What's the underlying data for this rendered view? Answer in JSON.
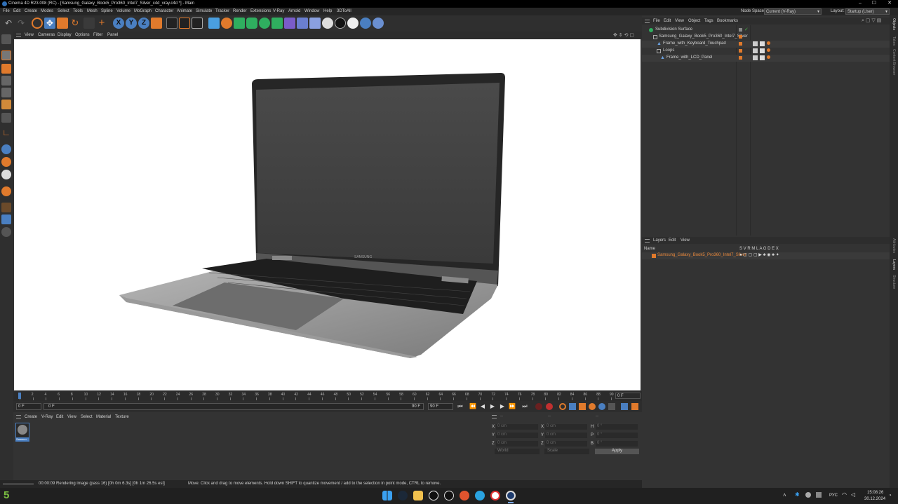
{
  "window": {
    "title": "Cinema 4D R23.008 (RC) - [Samsung_Galaxy_Book5_Pro360_Intel7_Silver_c4d_vray.c4d *] - Main",
    "controls": [
      "–",
      "☐",
      "✕"
    ]
  },
  "menubar": {
    "items": [
      "File",
      "Edit",
      "Create",
      "Modes",
      "Select",
      "Tools",
      "Mesh",
      "Spline",
      "Volume",
      "MoGraph",
      "Character",
      "Animate",
      "Simulate",
      "Tracker",
      "Render",
      "Extensions",
      "V-Ray",
      "Arnold",
      "Window",
      "Help",
      "3DToAll"
    ],
    "node_space_label": "Node Space:",
    "node_space_value": "Current (V-Ray)",
    "layout_label": "Layout:",
    "layout_value": "Startup (User)"
  },
  "toolbar": {
    "axis_x": "X",
    "axis_y": "Y",
    "axis_z": "Z",
    "icons": [
      "undo-icon",
      "redo-icon",
      "live-select-icon",
      "move-icon",
      "scale-icon",
      "rotate-icon",
      "recent-icon",
      "add-icon",
      "x-axis-icon",
      "y-axis-icon",
      "z-axis-icon",
      "coord-system-icon",
      "render-region-icon",
      "render-view-icon",
      "render-settings-icon",
      "cube-icon",
      "subdivision-icon",
      "boole-icon",
      "cloner-icon",
      "mograph-icon",
      "deformer-icon",
      "scene-icon",
      "floor-icon",
      "camera-icon",
      "light-icon",
      "vray-icon",
      "python-icon",
      "script-icon"
    ]
  },
  "viewport": {
    "menu": [
      "View",
      "Cameras",
      "Display",
      "Options",
      "Filter",
      "Panel"
    ],
    "laptop_brand": "SAMSUNG"
  },
  "timeline": {
    "ticks": [
      "0",
      "2",
      "4",
      "6",
      "8",
      "10",
      "12",
      "14",
      "16",
      "18",
      "20",
      "22",
      "24",
      "26",
      "28",
      "30",
      "32",
      "34",
      "36",
      "38",
      "40",
      "42",
      "44",
      "46",
      "48",
      "50",
      "52",
      "54",
      "56",
      "58",
      "60",
      "62",
      "64",
      "66",
      "68",
      "70",
      "72",
      "74",
      "76",
      "78",
      "80",
      "82",
      "84",
      "86",
      "88",
      "90"
    ],
    "current_frame": "0 F"
  },
  "transport": {
    "start": "0 F",
    "current": "0 F",
    "end_inner": "90 F",
    "end": "90 F"
  },
  "material_panel": {
    "menu": [
      "Create",
      "V-Ray",
      "Edit",
      "View",
      "Select",
      "Material",
      "Texture"
    ],
    "material_name": "Samsun"
  },
  "coord_panel": {
    "header_left": "--",
    "header_mid": "--",
    "header_right": "--",
    "rows": [
      {
        "a": "X",
        "av": "0 cm",
        "b": "X",
        "bv": "0 cm",
        "c": "H",
        "cv": "0 °"
      },
      {
        "a": "Y",
        "av": "0 cm",
        "b": "Y",
        "bv": "0 cm",
        "c": "P",
        "cv": "0 °"
      },
      {
        "a": "Z",
        "av": "0 cm",
        "b": "Z",
        "bv": "0 cm",
        "c": "B",
        "cv": "0 °"
      }
    ],
    "mode_world": "World",
    "mode_scale": "Scale",
    "apply": "Apply"
  },
  "status": {
    "render": "00:00:09 Rendering image (pass 16) [0h  0m  6.3s] [0h  1m 26.5s est]",
    "hint": "Move: Click and drag to move elements. Hold down SHIFT to quantize movement / add to the selection in point mode, CTRL to remove."
  },
  "object_manager": {
    "menu": [
      "File",
      "Edit",
      "View",
      "Object",
      "Tags",
      "Bookmarks"
    ],
    "objects": [
      {
        "name": "Subdivision Surface",
        "indent": 0
      },
      {
        "name": "Samsung_Galaxy_Book5_Pro360_Intel7_Silver",
        "indent": 1
      },
      {
        "name": "Frame_with_Keyboard_Touchpad",
        "indent": 2
      },
      {
        "name": "Loops",
        "indent": 2
      },
      {
        "name": "Frame_with_LCD_Panel",
        "indent": 3
      }
    ]
  },
  "layer_manager": {
    "menu": [
      "Layers",
      "Edit",
      "View"
    ],
    "name_header": "Name",
    "flags": "S V R M L A G D E X",
    "layers": [
      {
        "name": "Samsung_Galaxy_Book5_Pro360_Intel7_Silver"
      }
    ]
  },
  "right_tabs": [
    "Objects",
    "Takes",
    "Content Browser",
    "Attributes",
    "Layers",
    "Structure"
  ],
  "taskbar": {
    "left_badge": "5",
    "lang": "РУС",
    "time": "15:08:26",
    "date": "30.12.2024",
    "icons": [
      "windows-start-icon",
      "steam-icon",
      "file-explorer-icon",
      "unreal-icon",
      "github-icon",
      "browser-icon",
      "telegram-icon",
      "yandex-icon",
      "cinema4d-icon"
    ]
  },
  "colors": {
    "accent_orange": "#e07a2c",
    "accent_blue": "#4a7fc1",
    "layer_text": "#e8873a"
  }
}
